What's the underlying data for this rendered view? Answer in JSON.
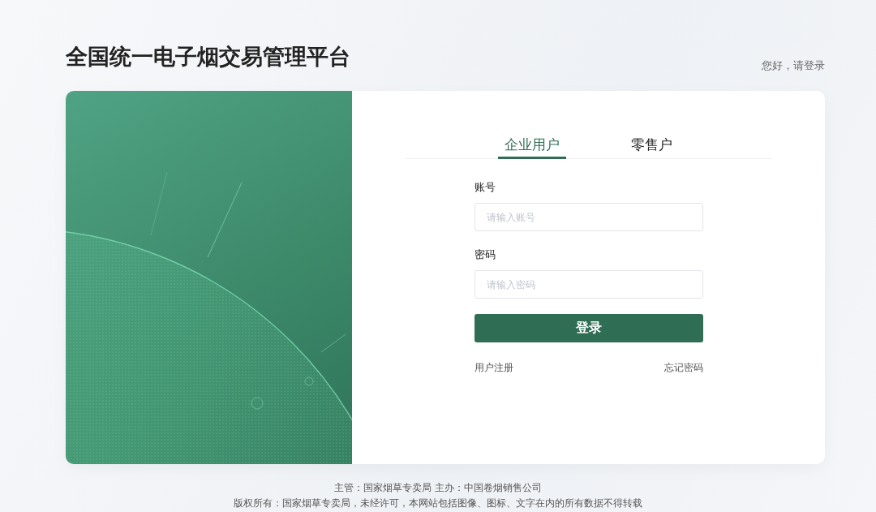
{
  "header": {
    "title": "全国统一电子烟交易管理平台",
    "greeting": "您好，请登录"
  },
  "tabs": [
    {
      "label": "企业用户",
      "selected": true
    },
    {
      "label": "零售户",
      "selected": false
    }
  ],
  "fields": [
    {
      "label": "账号",
      "placeholder": "请输入账号"
    },
    {
      "label": "密码",
      "placeholder": "请输入密码"
    }
  ],
  "login_button": "登录",
  "links": [
    "用户注册",
    "忘记密码"
  ],
  "footer": [
    "主管：国家烟草专卖局 主办：中国卷烟销售公司",
    "版权所有：国家烟草专卖局，未经许可，本网站包括图像、图标、文字在内的所有数据不得转载"
  ]
}
